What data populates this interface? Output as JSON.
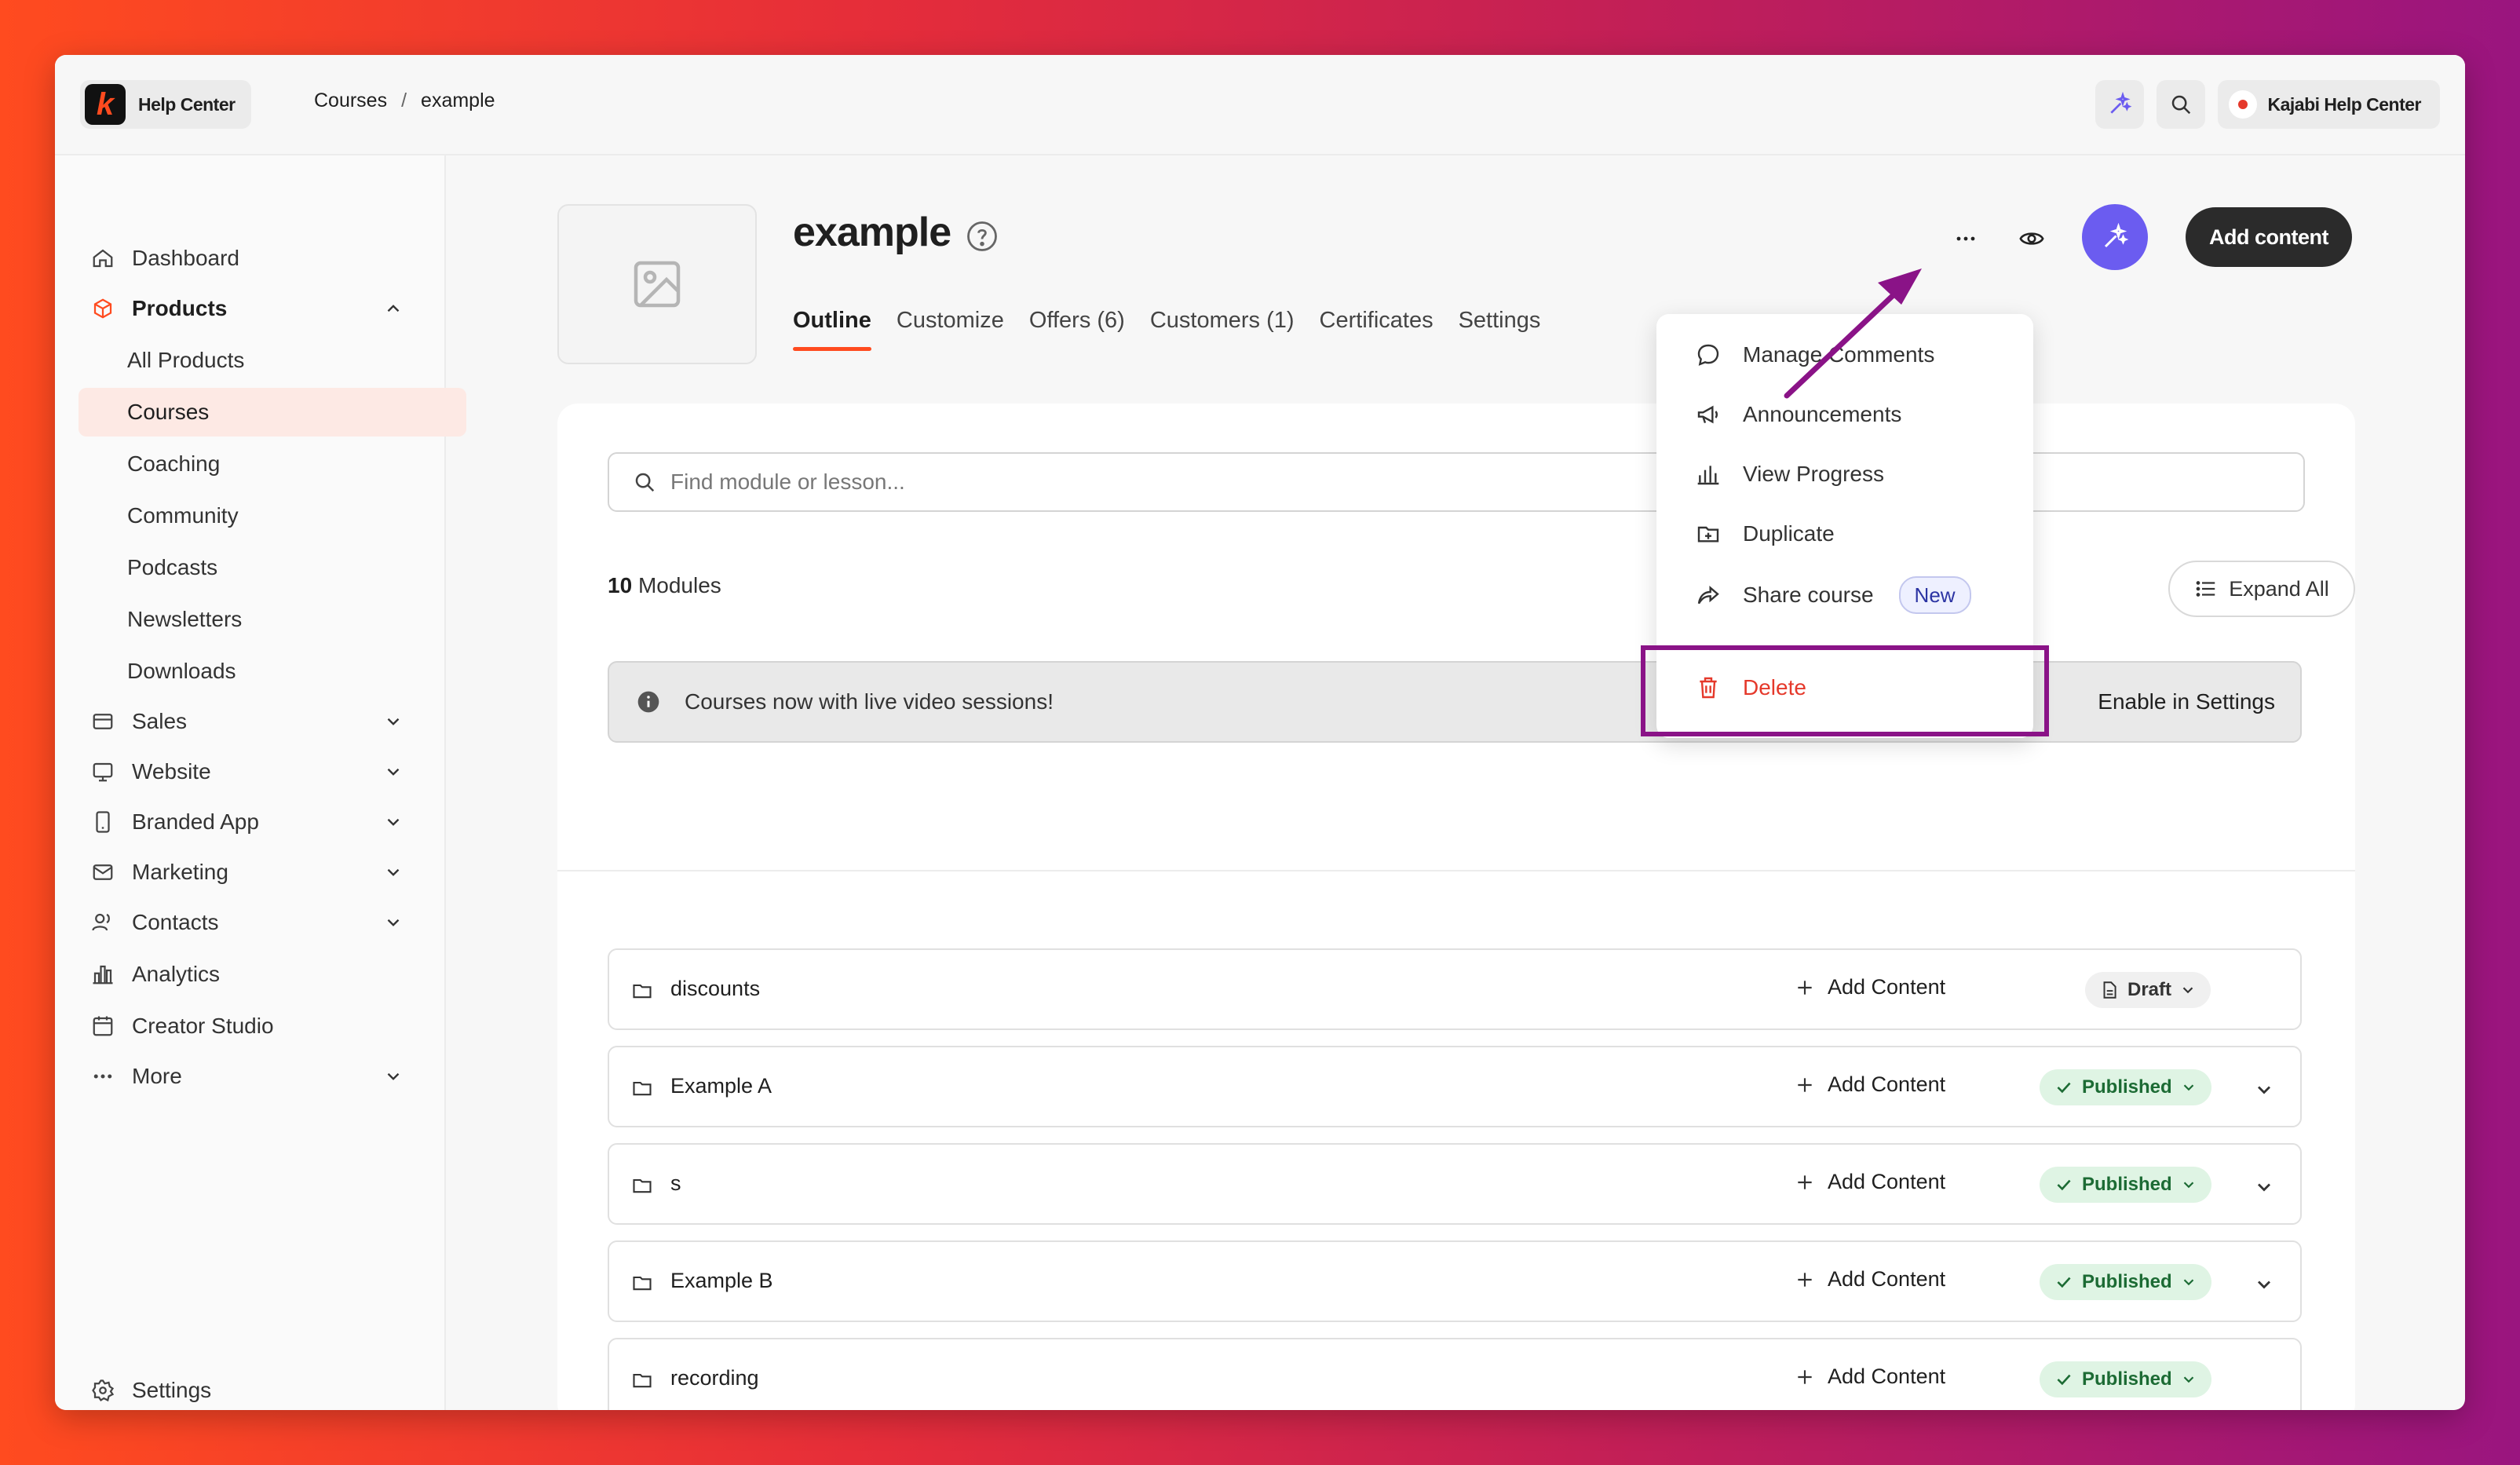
{
  "brand": {
    "label": "Help Center"
  },
  "breadcrumb": {
    "parent": "Courses",
    "separator": "/",
    "current": "example"
  },
  "account": {
    "name": "Kajabi Help Center"
  },
  "sidebar": {
    "items": [
      {
        "label": "Dashboard"
      },
      {
        "label": "Products"
      },
      {
        "label": "All Products"
      },
      {
        "label": "Courses"
      },
      {
        "label": "Coaching"
      },
      {
        "label": "Community"
      },
      {
        "label": "Podcasts"
      },
      {
        "label": "Newsletters"
      },
      {
        "label": "Downloads"
      },
      {
        "label": "Sales"
      },
      {
        "label": "Website"
      },
      {
        "label": "Branded App"
      },
      {
        "label": "Marketing"
      },
      {
        "label": "Contacts"
      },
      {
        "label": "Analytics"
      },
      {
        "label": "Creator Studio"
      },
      {
        "label": "More"
      }
    ],
    "settings_label": "Settings"
  },
  "course": {
    "title": "example",
    "tabs": [
      "Outline",
      "Customize",
      "Offers (6)",
      "Customers (1)",
      "Certificates",
      "Settings"
    ],
    "add_content_label": "Add content"
  },
  "outline": {
    "search_placeholder": "Find module or lesson...",
    "modules_count": "10",
    "modules_label": "Modules",
    "expand_all_label": "Expand All",
    "banner_text": "Courses now with live video sessions!",
    "banner_action": "Enable in Settings",
    "add_content_label": "Add Content",
    "modules": [
      {
        "name": "discounts",
        "status": "Draft"
      },
      {
        "name": "Example A",
        "status": "Published"
      },
      {
        "name": "s",
        "status": "Published"
      },
      {
        "name": "Example B",
        "status": "Published"
      },
      {
        "name": "recording",
        "status": "Published"
      }
    ]
  },
  "menu": {
    "items": [
      {
        "label": "Manage Comments",
        "icon": "comment-icon"
      },
      {
        "label": "Announcements",
        "icon": "megaphone-icon"
      },
      {
        "label": "View Progress",
        "icon": "bar-chart-icon"
      },
      {
        "label": "Duplicate",
        "icon": "duplicate-icon"
      },
      {
        "label": "Share course",
        "icon": "share-icon",
        "badge": "New"
      }
    ],
    "delete_label": "Delete"
  },
  "colors": {
    "accent": "#ff4b1f",
    "danger": "#e5392b",
    "annotation": "#8a1387",
    "magic": "#6b5cf0",
    "published": "#1c6b34"
  }
}
